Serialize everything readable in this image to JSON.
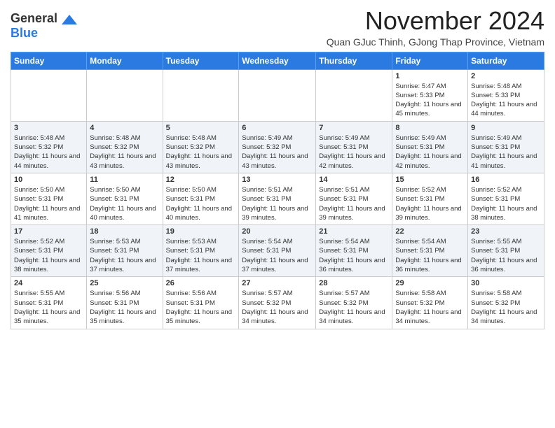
{
  "header": {
    "logo_line1": "General",
    "logo_line2": "Blue",
    "month": "November 2024",
    "location": "Quan GJuc Thinh, GJong Thap Province, Vietnam"
  },
  "weekdays": [
    "Sunday",
    "Monday",
    "Tuesday",
    "Wednesday",
    "Thursday",
    "Friday",
    "Saturday"
  ],
  "weeks": [
    [
      {
        "day": "",
        "info": ""
      },
      {
        "day": "",
        "info": ""
      },
      {
        "day": "",
        "info": ""
      },
      {
        "day": "",
        "info": ""
      },
      {
        "day": "",
        "info": ""
      },
      {
        "day": "1",
        "info": "Sunrise: 5:47 AM\nSunset: 5:33 PM\nDaylight: 11 hours and 45 minutes."
      },
      {
        "day": "2",
        "info": "Sunrise: 5:48 AM\nSunset: 5:33 PM\nDaylight: 11 hours and 44 minutes."
      }
    ],
    [
      {
        "day": "3",
        "info": "Sunrise: 5:48 AM\nSunset: 5:32 PM\nDaylight: 11 hours and 44 minutes."
      },
      {
        "day": "4",
        "info": "Sunrise: 5:48 AM\nSunset: 5:32 PM\nDaylight: 11 hours and 43 minutes."
      },
      {
        "day": "5",
        "info": "Sunrise: 5:48 AM\nSunset: 5:32 PM\nDaylight: 11 hours and 43 minutes."
      },
      {
        "day": "6",
        "info": "Sunrise: 5:49 AM\nSunset: 5:32 PM\nDaylight: 11 hours and 43 minutes."
      },
      {
        "day": "7",
        "info": "Sunrise: 5:49 AM\nSunset: 5:31 PM\nDaylight: 11 hours and 42 minutes."
      },
      {
        "day": "8",
        "info": "Sunrise: 5:49 AM\nSunset: 5:31 PM\nDaylight: 11 hours and 42 minutes."
      },
      {
        "day": "9",
        "info": "Sunrise: 5:49 AM\nSunset: 5:31 PM\nDaylight: 11 hours and 41 minutes."
      }
    ],
    [
      {
        "day": "10",
        "info": "Sunrise: 5:50 AM\nSunset: 5:31 PM\nDaylight: 11 hours and 41 minutes."
      },
      {
        "day": "11",
        "info": "Sunrise: 5:50 AM\nSunset: 5:31 PM\nDaylight: 11 hours and 40 minutes."
      },
      {
        "day": "12",
        "info": "Sunrise: 5:50 AM\nSunset: 5:31 PM\nDaylight: 11 hours and 40 minutes."
      },
      {
        "day": "13",
        "info": "Sunrise: 5:51 AM\nSunset: 5:31 PM\nDaylight: 11 hours and 39 minutes."
      },
      {
        "day": "14",
        "info": "Sunrise: 5:51 AM\nSunset: 5:31 PM\nDaylight: 11 hours and 39 minutes."
      },
      {
        "day": "15",
        "info": "Sunrise: 5:52 AM\nSunset: 5:31 PM\nDaylight: 11 hours and 39 minutes."
      },
      {
        "day": "16",
        "info": "Sunrise: 5:52 AM\nSunset: 5:31 PM\nDaylight: 11 hours and 38 minutes."
      }
    ],
    [
      {
        "day": "17",
        "info": "Sunrise: 5:52 AM\nSunset: 5:31 PM\nDaylight: 11 hours and 38 minutes."
      },
      {
        "day": "18",
        "info": "Sunrise: 5:53 AM\nSunset: 5:31 PM\nDaylight: 11 hours and 37 minutes."
      },
      {
        "day": "19",
        "info": "Sunrise: 5:53 AM\nSunset: 5:31 PM\nDaylight: 11 hours and 37 minutes."
      },
      {
        "day": "20",
        "info": "Sunrise: 5:54 AM\nSunset: 5:31 PM\nDaylight: 11 hours and 37 minutes."
      },
      {
        "day": "21",
        "info": "Sunrise: 5:54 AM\nSunset: 5:31 PM\nDaylight: 11 hours and 36 minutes."
      },
      {
        "day": "22",
        "info": "Sunrise: 5:54 AM\nSunset: 5:31 PM\nDaylight: 11 hours and 36 minutes."
      },
      {
        "day": "23",
        "info": "Sunrise: 5:55 AM\nSunset: 5:31 PM\nDaylight: 11 hours and 36 minutes."
      }
    ],
    [
      {
        "day": "24",
        "info": "Sunrise: 5:55 AM\nSunset: 5:31 PM\nDaylight: 11 hours and 35 minutes."
      },
      {
        "day": "25",
        "info": "Sunrise: 5:56 AM\nSunset: 5:31 PM\nDaylight: 11 hours and 35 minutes."
      },
      {
        "day": "26",
        "info": "Sunrise: 5:56 AM\nSunset: 5:31 PM\nDaylight: 11 hours and 35 minutes."
      },
      {
        "day": "27",
        "info": "Sunrise: 5:57 AM\nSunset: 5:32 PM\nDaylight: 11 hours and 34 minutes."
      },
      {
        "day": "28",
        "info": "Sunrise: 5:57 AM\nSunset: 5:32 PM\nDaylight: 11 hours and 34 minutes."
      },
      {
        "day": "29",
        "info": "Sunrise: 5:58 AM\nSunset: 5:32 PM\nDaylight: 11 hours and 34 minutes."
      },
      {
        "day": "30",
        "info": "Sunrise: 5:58 AM\nSunset: 5:32 PM\nDaylight: 11 hours and 34 minutes."
      }
    ]
  ]
}
